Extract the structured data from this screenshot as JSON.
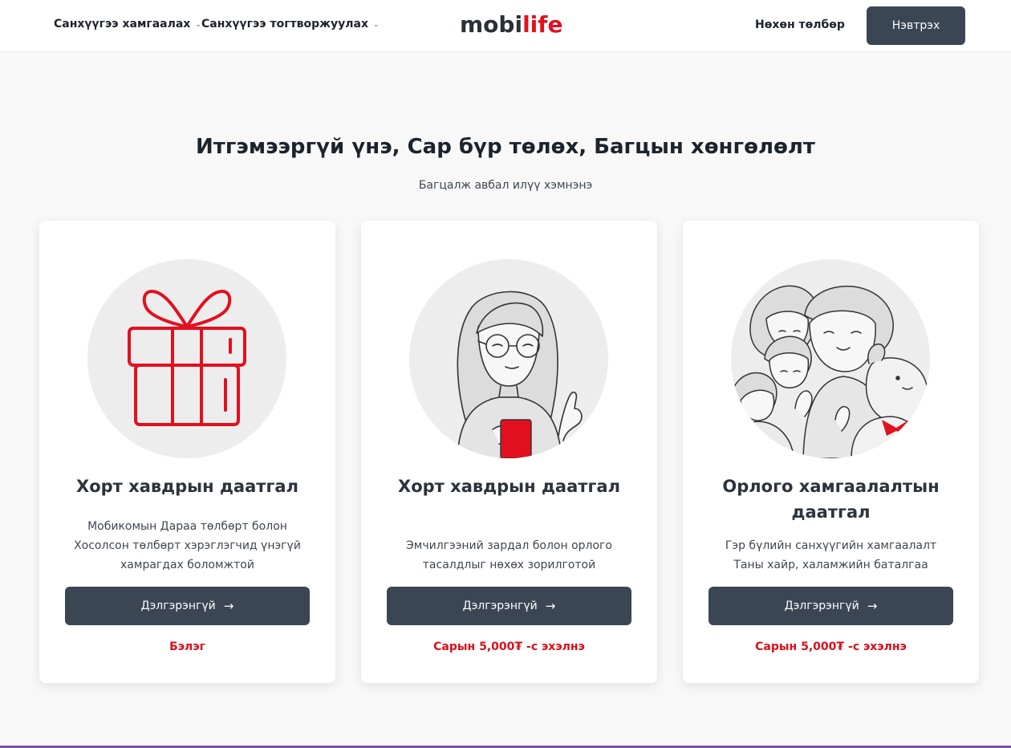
{
  "header": {
    "nav_protect": "Санхүүгээ хамгаалах",
    "nav_stabilize": "Санхүүгээ тогтворжуулах",
    "logo_part1": "mobi",
    "logo_part2": "life",
    "pay_link": "Нөхөн төлбөр",
    "login_button": "Нэвтрэх"
  },
  "hero": {
    "title": "Итгэмээргүй үнэ, Сар бүр төлөх, Багцын хөнгөлөлт",
    "subtitle": "Багцалж авбал илүү хэмнэнэ"
  },
  "cards": [
    {
      "title": "Хорт хавдрын даатгал",
      "desc_lines": [
        "Мобикомын Дараа төлбөрт болон",
        "Хосолсон төлбөрт хэрэглэгчид үнэгүй",
        "хамрагдах боломжтой"
      ],
      "button": "Дэлгэрэнгүй",
      "price": "Бэлэг",
      "icon": "gift-icon"
    },
    {
      "title": "Хорт хавдрын даатгал",
      "desc_lines": [
        "Эмчилгээний зардал болон орлого",
        "тасалдлыг нөхөх зорилготой"
      ],
      "button": "Дэлгэрэнгүй",
      "price": "Сарын 5,000₮ -с эхэлнэ",
      "icon": "woman-with-phone-illustration"
    },
    {
      "title": "Орлого хамгаалалтын даатгал",
      "desc_lines": [
        "Гэр бүлийн санхүүгийн хамгаалалт",
        "Таны хайр, халамжийн баталгаа"
      ],
      "button": "Дэлгэрэнгүй",
      "price": "Сарын 5,000₮ -с эхэлнэ",
      "icon": "family-illustration"
    }
  ],
  "colors": {
    "accent_red": "#e2101f",
    "button_dark": "#3a4654",
    "price_red": "#d8101c",
    "bottom_line": "#7a52a3"
  }
}
